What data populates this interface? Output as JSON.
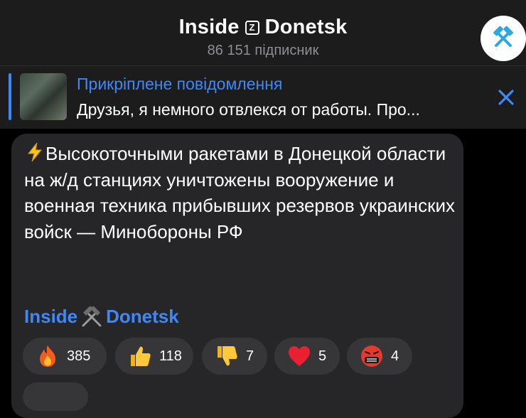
{
  "header": {
    "title_left": "Inside",
    "title_badge": "Z",
    "title_right": "Donetsk",
    "subscribers": "86 151 підписник",
    "avatar_icon": "crossed-hammers-icon"
  },
  "pinned": {
    "title": "Прикріплене повідомлення",
    "text": "Друзья, я немного отвлекся от работы. Про...",
    "close_icon": "close-icon"
  },
  "message": {
    "lead_icon": "lightning-icon",
    "text": "Высокоточными ракетами в Донецкой области на ж/д станциях уничтожены вооружение и военная техника прибывших резервов украинских войск — Минобороны РФ",
    "signature_left": "Inside",
    "signature_right": "Donetsk"
  },
  "reactions": [
    {
      "icon": "fire-icon",
      "count": "385"
    },
    {
      "icon": "thumbs-up-icon",
      "count": "118"
    },
    {
      "icon": "thumbs-down-icon",
      "count": "7"
    },
    {
      "icon": "heart-icon",
      "count": "5"
    },
    {
      "icon": "angry-face-icon",
      "count": "4"
    }
  ],
  "colors": {
    "accent": "#3e88f7",
    "background": "#000000",
    "bubble": "#262628",
    "header": "#1c1c1d"
  }
}
